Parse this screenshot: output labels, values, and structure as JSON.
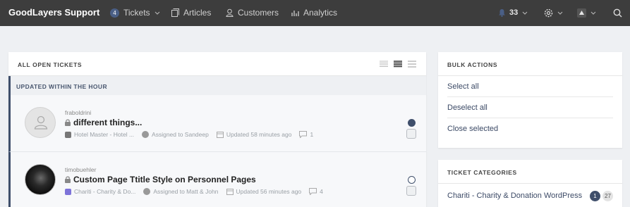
{
  "topbar": {
    "brand": "GoodLayers Support",
    "nav": {
      "tickets": {
        "badge": "4",
        "label": "Tickets"
      },
      "articles": {
        "label": "Articles"
      },
      "customers": {
        "label": "Customers"
      },
      "analytics": {
        "label": "Analytics"
      }
    },
    "notifications_count": "33"
  },
  "main": {
    "title": "ALL OPEN TICKETS",
    "section_title": "UPDATED WITHIN THE HOUR",
    "tickets": [
      {
        "author": "fraboldrini",
        "subject": "different things...",
        "product": "Hotel Master - Hotel ...",
        "assigned": "Assigned to Sandeep",
        "updated": "Updated 58 minutes ago",
        "comments": "1",
        "status": "filled"
      },
      {
        "author": "timobuehler",
        "subject": "Custom Page Ttitle Style on Personnel Pages",
        "product": "Chariti - Charity & Do...",
        "assigned": "Assigned to Matt & John",
        "updated": "Updated 56 minutes ago",
        "comments": "4",
        "status": "open"
      }
    ]
  },
  "bulk": {
    "title": "BULK ACTIONS",
    "select_all": "Select all",
    "deselect_all": "Deselect all",
    "close_selected": "Close selected"
  },
  "categories": {
    "title": "TICKET CATEGORIES",
    "items": [
      {
        "name": "Chariti - Charity & Donation WordPress",
        "count_primary": "1",
        "count_secondary": "27"
      }
    ]
  },
  "colors": {
    "accent": "#3f4f6b",
    "topbar": "#3d3d3d",
    "background": "#eef0f3"
  },
  "icons": [
    "ticket-badge",
    "chevron-down-icon",
    "articles-icon",
    "customers-icon",
    "analytics-icon",
    "bell-icon",
    "gear-icon",
    "user-avatar-icon",
    "search-icon",
    "lock-icon",
    "calendar-icon",
    "comment-icon"
  ]
}
